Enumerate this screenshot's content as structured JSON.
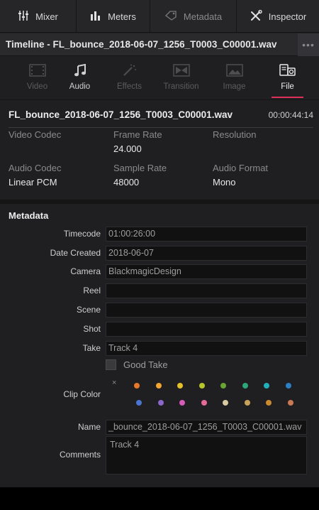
{
  "toolbar": {
    "items": [
      {
        "label": "Mixer",
        "icon": "mixer-icon"
      },
      {
        "label": "Meters",
        "icon": "meters-icon"
      },
      {
        "label": "Metadata",
        "icon": "metadata-icon"
      },
      {
        "label": "Inspector",
        "icon": "inspector-icon"
      }
    ]
  },
  "timeline": {
    "title": "Timeline - FL_bounce_2018-06-07_1256_T0003_C00001.wav",
    "more": "•••"
  },
  "tabs": [
    {
      "label": "Video"
    },
    {
      "label": "Audio"
    },
    {
      "label": "Effects"
    },
    {
      "label": "Transition"
    },
    {
      "label": "Image"
    },
    {
      "label": "File"
    }
  ],
  "file": {
    "name": "FL_bounce_2018-06-07_1256_T0003_C00001.wav",
    "duration": "00:00:44:14"
  },
  "props": {
    "video_codec_label": "Video Codec",
    "video_codec_value": "",
    "frame_rate_label": "Frame Rate",
    "frame_rate_value": "24.000",
    "resolution_label": "Resolution",
    "resolution_value": "",
    "audio_codec_label": "Audio Codec",
    "audio_codec_value": "Linear PCM",
    "sample_rate_label": "Sample Rate",
    "sample_rate_value": "48000",
    "audio_format_label": "Audio Format",
    "audio_format_value": "Mono"
  },
  "metadata": {
    "title": "Metadata",
    "timecode_label": "Timecode",
    "timecode_value": "01:00:26:00",
    "date_label": "Date Created",
    "date_value": "2018-06-07",
    "camera_label": "Camera",
    "camera_value": "BlackmagicDesign",
    "reel_label": "Reel",
    "reel_value": "",
    "scene_label": "Scene",
    "scene_value": "",
    "shot_label": "Shot",
    "shot_value": "",
    "take_label": "Take",
    "take_value": "Track 4",
    "good_take_label": "Good Take",
    "clip_color_label": "Clip Color",
    "clip_color_none": "×",
    "clip_colors_row1": [
      "#e8782a",
      "#f2a531",
      "#e6c029",
      "#b7c42b",
      "#6aa534",
      "#2fa67a",
      "#22b0b8",
      "#2b7fc4"
    ],
    "clip_colors_row2": [
      "#4a74d0",
      "#8c66c9",
      "#d65ab8",
      "#e46a9a",
      "#d9caa2",
      "#c8a25a",
      "#cc8a2e",
      "#c97a52"
    ],
    "name_label": "Name",
    "name_value": "_bounce_2018-06-07_1256_T0003_C00001.wav",
    "comments_label": "Comments",
    "comments_value": "Track 4"
  }
}
